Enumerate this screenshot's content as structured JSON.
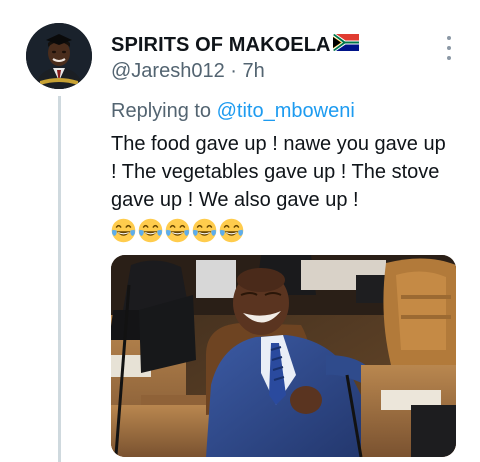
{
  "author": {
    "display_name": "SPIRITS OF MAKOELA",
    "flag_icon": "south-africa-flag-icon",
    "handle": "@Jaresh012",
    "separator": " · ",
    "time": "7h"
  },
  "reply": {
    "prefix": "Replying to ",
    "mention": "@tito_mboweni"
  },
  "tweet": {
    "text": "The food gave up ! nawe you gave up ! The vegetables gave up ! The stove gave up ! We also gave up !",
    "emojis": [
      "face-with-tears-of-joy-icon",
      "face-with-tears-of-joy-icon",
      "face-with-tears-of-joy-icon",
      "face-with-tears-of-joy-icon",
      "face-with-tears-of-joy-icon"
    ],
    "emoji_count": 5
  },
  "media": {
    "kind": "photo",
    "subject": "laughing man in blue suit seated in parliament chamber"
  },
  "colors": {
    "text": "#0f1419",
    "secondary": "#536471",
    "link": "#1d9bf0",
    "thread_line": "#cfd9de"
  },
  "icons": {
    "more": "more-options-icon"
  }
}
